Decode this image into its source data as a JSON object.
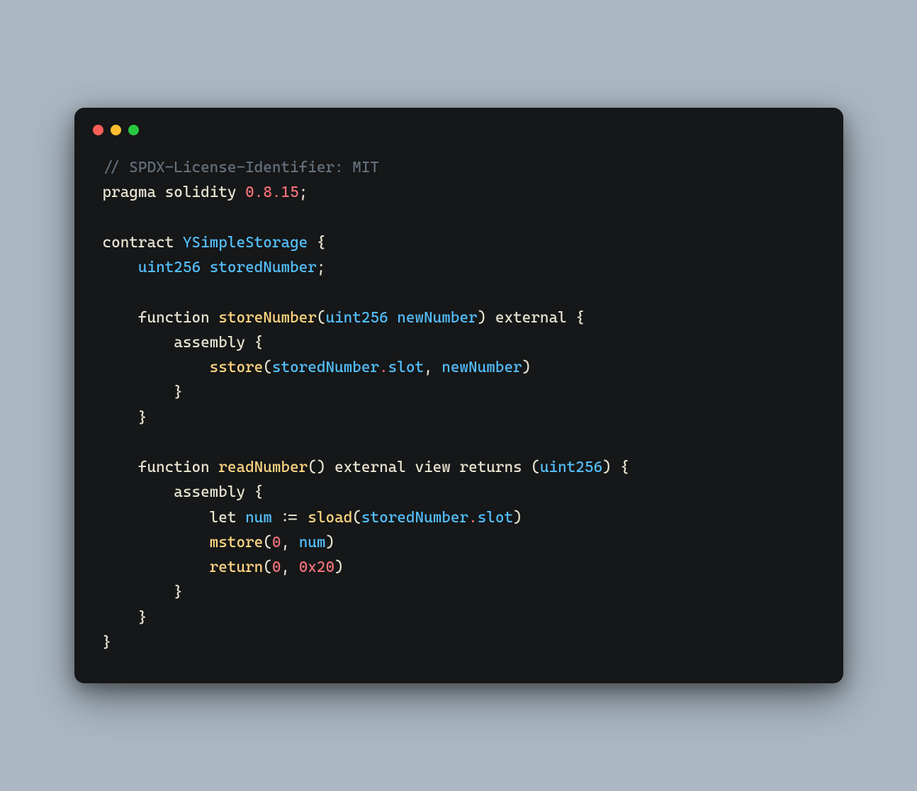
{
  "window": {
    "dots": [
      "red",
      "yellow",
      "green"
    ]
  },
  "code": {
    "tokens": [
      [
        [
          "c-comment",
          "// SPDX-License-Identifier: MIT"
        ]
      ],
      [
        [
          "c-keyword",
          "pragma"
        ],
        [
          "sp",
          " "
        ],
        [
          "c-keyword",
          "solidity"
        ],
        [
          "sp",
          " "
        ],
        [
          "c-num",
          "0"
        ],
        [
          "c-dot",
          "."
        ],
        [
          "c-num",
          "8"
        ],
        [
          "c-dot",
          "."
        ],
        [
          "c-num",
          "15"
        ],
        [
          "c-punct",
          ";"
        ]
      ],
      [],
      [
        [
          "c-keyword",
          "contract"
        ],
        [
          "sp",
          " "
        ],
        [
          "c-type",
          "YSimpleStorage"
        ],
        [
          "sp",
          " "
        ],
        [
          "c-punct",
          "{"
        ]
      ],
      [
        [
          "sp",
          "    "
        ],
        [
          "c-type",
          "uint256"
        ],
        [
          "sp",
          " "
        ],
        [
          "c-prop",
          "storedNumber"
        ],
        [
          "c-punct",
          ";"
        ]
      ],
      [],
      [
        [
          "sp",
          "    "
        ],
        [
          "c-keyword",
          "function"
        ],
        [
          "sp",
          " "
        ],
        [
          "c-func",
          "storeNumber"
        ],
        [
          "c-punct",
          "("
        ],
        [
          "c-type",
          "uint256"
        ],
        [
          "sp",
          " "
        ],
        [
          "c-prop",
          "newNumber"
        ],
        [
          "c-punct",
          ")"
        ],
        [
          "sp",
          " "
        ],
        [
          "c-keyword",
          "external"
        ],
        [
          "sp",
          " "
        ],
        [
          "c-punct",
          "{"
        ]
      ],
      [
        [
          "sp",
          "        "
        ],
        [
          "c-keyword",
          "assembly"
        ],
        [
          "sp",
          " "
        ],
        [
          "c-punct",
          "{"
        ]
      ],
      [
        [
          "sp",
          "            "
        ],
        [
          "c-func",
          "sstore"
        ],
        [
          "c-punct",
          "("
        ],
        [
          "c-prop",
          "storedNumber"
        ],
        [
          "c-dot",
          "."
        ],
        [
          "c-prop",
          "slot"
        ],
        [
          "c-punct",
          ","
        ],
        [
          "sp",
          " "
        ],
        [
          "c-prop",
          "newNumber"
        ],
        [
          "c-punct",
          ")"
        ]
      ],
      [
        [
          "sp",
          "        "
        ],
        [
          "c-punct",
          "}"
        ]
      ],
      [
        [
          "sp",
          "    "
        ],
        [
          "c-punct",
          "}"
        ]
      ],
      [],
      [
        [
          "sp",
          "    "
        ],
        [
          "c-keyword",
          "function"
        ],
        [
          "sp",
          " "
        ],
        [
          "c-func",
          "readNumber"
        ],
        [
          "c-punct",
          "()"
        ],
        [
          "sp",
          " "
        ],
        [
          "c-keyword",
          "external"
        ],
        [
          "sp",
          " "
        ],
        [
          "c-keyword",
          "view"
        ],
        [
          "sp",
          " "
        ],
        [
          "c-keyword",
          "returns"
        ],
        [
          "sp",
          " "
        ],
        [
          "c-punct",
          "("
        ],
        [
          "c-type",
          "uint256"
        ],
        [
          "c-punct",
          ")"
        ],
        [
          "sp",
          " "
        ],
        [
          "c-punct",
          "{"
        ]
      ],
      [
        [
          "sp",
          "        "
        ],
        [
          "c-keyword",
          "assembly"
        ],
        [
          "sp",
          " "
        ],
        [
          "c-punct",
          "{"
        ]
      ],
      [
        [
          "sp",
          "            "
        ],
        [
          "c-keyword",
          "let"
        ],
        [
          "sp",
          " "
        ],
        [
          "c-prop",
          "num"
        ],
        [
          "sp",
          " "
        ],
        [
          "c-punct",
          ":="
        ],
        [
          "sp",
          " "
        ],
        [
          "c-func",
          "sload"
        ],
        [
          "c-punct",
          "("
        ],
        [
          "c-prop",
          "storedNumber"
        ],
        [
          "c-dot",
          "."
        ],
        [
          "c-prop",
          "slot"
        ],
        [
          "c-punct",
          ")"
        ]
      ],
      [
        [
          "sp",
          "            "
        ],
        [
          "c-func",
          "mstore"
        ],
        [
          "c-punct",
          "("
        ],
        [
          "c-num",
          "0"
        ],
        [
          "c-punct",
          ","
        ],
        [
          "sp",
          " "
        ],
        [
          "c-prop",
          "num"
        ],
        [
          "c-punct",
          ")"
        ]
      ],
      [
        [
          "sp",
          "            "
        ],
        [
          "c-func",
          "return"
        ],
        [
          "c-punct",
          "("
        ],
        [
          "c-num",
          "0"
        ],
        [
          "c-punct",
          ","
        ],
        [
          "sp",
          " "
        ],
        [
          "c-num",
          "0x20"
        ],
        [
          "c-punct",
          ")"
        ]
      ],
      [
        [
          "sp",
          "        "
        ],
        [
          "c-punct",
          "}"
        ]
      ],
      [
        [
          "sp",
          "    "
        ],
        [
          "c-punct",
          "}"
        ]
      ],
      [
        [
          "c-punct",
          "}"
        ]
      ]
    ]
  }
}
